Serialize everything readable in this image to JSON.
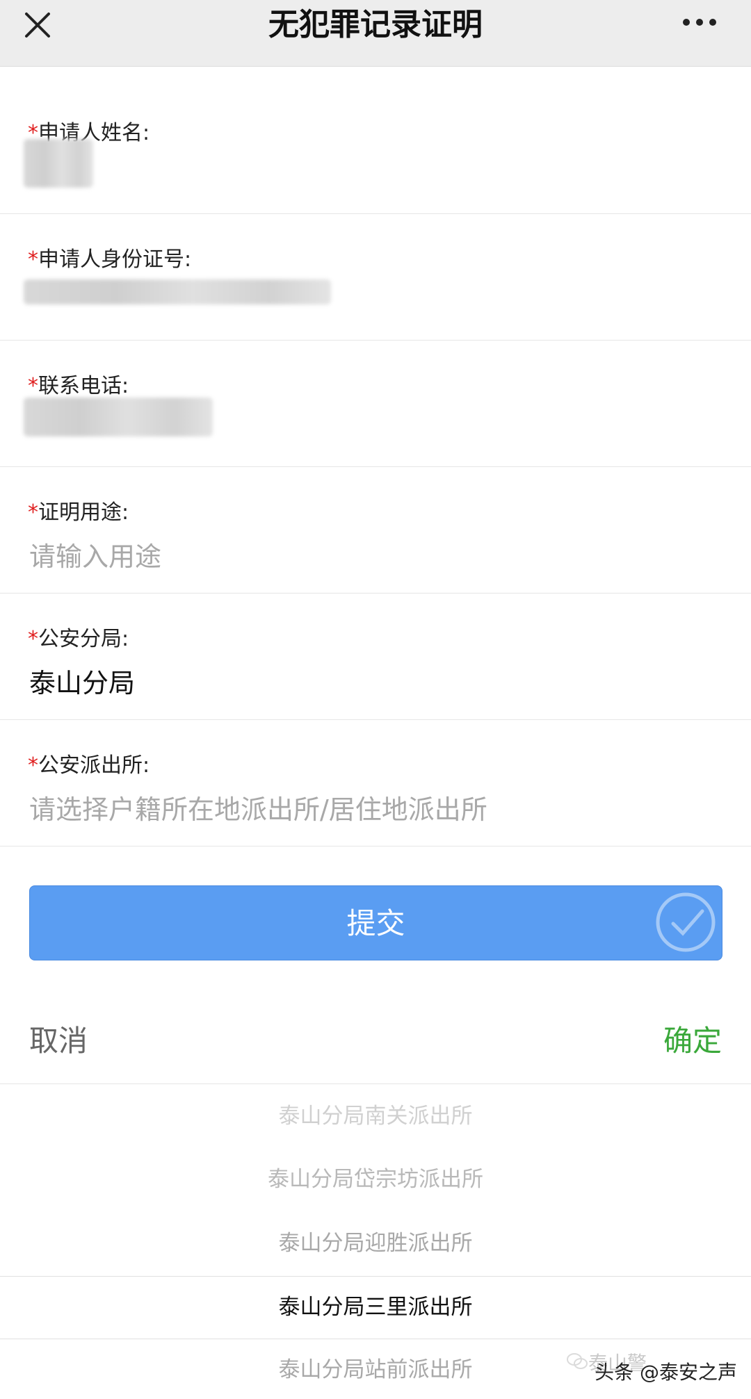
{
  "header": {
    "title": "无犯罪记录证明"
  },
  "form": {
    "required_mark": "*",
    "name": {
      "label": "申请人姓名:"
    },
    "id_number": {
      "label": "申请人身份证号:"
    },
    "phone": {
      "label": "联系电话:"
    },
    "purpose": {
      "label": "证明用途:",
      "placeholder": "请输入用途"
    },
    "bureau": {
      "label": "公安分局:",
      "value": "泰山分局"
    },
    "station": {
      "label": "公安派出所:",
      "placeholder": "请选择户籍所在地派出所/居住地派出所"
    }
  },
  "submit": {
    "label": "提交"
  },
  "picker": {
    "cancel_label": "取消",
    "confirm_label": "确定",
    "confirm_color": "#3aa83a",
    "options": [
      "泰山分局南关派出所",
      "泰山分局岱宗坊派出所",
      "泰山分局迎胜派出所",
      "泰山分局三里派出所",
      "泰山分局站前派出所"
    ],
    "selected_index": 3
  },
  "watermark": {
    "text": "头条 @泰安之声",
    "ghost_text": "泰山警"
  },
  "colors": {
    "accent": "#5a9df2",
    "required": "#e02020",
    "topbar": "#ededed"
  }
}
